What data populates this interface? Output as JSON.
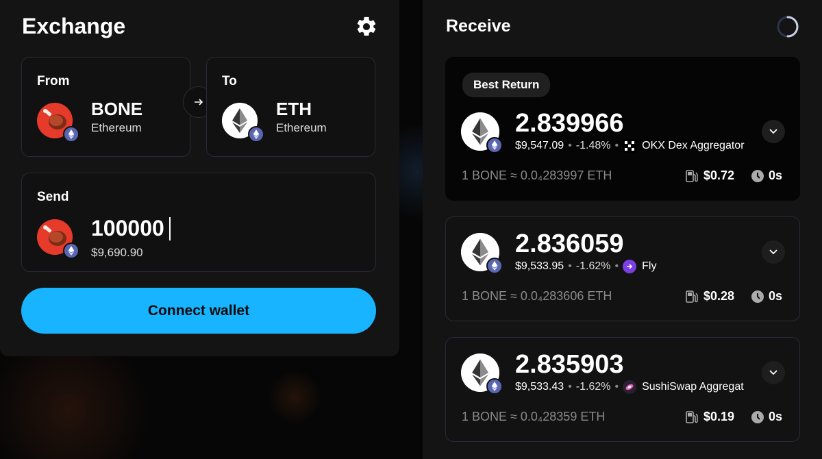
{
  "exchange": {
    "title": "Exchange",
    "from": {
      "label": "From",
      "symbol": "BONE",
      "chain": "Ethereum"
    },
    "to": {
      "label": "To",
      "symbol": "ETH",
      "chain": "Ethereum"
    },
    "send": {
      "label": "Send",
      "amount": "100000",
      "usd_value": "$9,690.90"
    },
    "connect_label": "Connect wallet"
  },
  "receive": {
    "title": "Receive",
    "best_badge": "Best Return",
    "quotes": [
      {
        "amount": "2.839966",
        "usd": "$9,547.09",
        "change": "-1.48%",
        "aggregator": "OKX Dex Aggregator",
        "rate": "1 BONE ≈ 0.0₄283997 ETH",
        "gas": "$0.72",
        "time": "0s"
      },
      {
        "amount": "2.836059",
        "usd": "$9,533.95",
        "change": "-1.62%",
        "aggregator": "Fly",
        "rate": "1 BONE ≈ 0.0₄283606 ETH",
        "gas": "$0.28",
        "time": "0s"
      },
      {
        "amount": "2.835903",
        "usd": "$9,533.43",
        "change": "-1.62%",
        "aggregator": "SushiSwap Aggregat",
        "rate": "1 BONE ≈ 0.0₄28359 ETH",
        "gas": "$0.19",
        "time": "0s"
      }
    ]
  },
  "colors": {
    "accent": "#18b4ff",
    "panel": "#141414",
    "border": "#2a2a38",
    "eth_badge": "#5a66b0",
    "bone": "#e63a2a"
  }
}
